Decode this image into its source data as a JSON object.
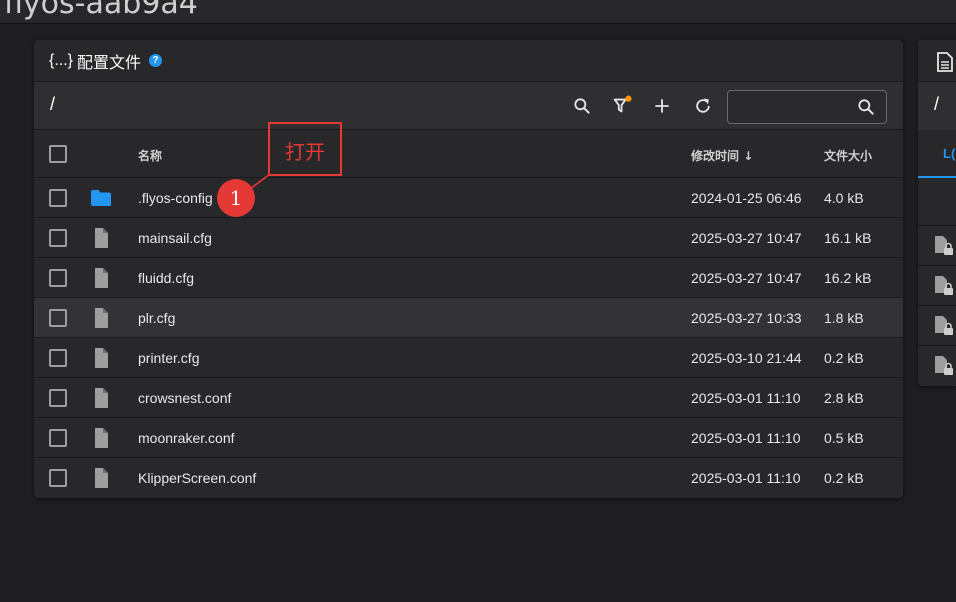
{
  "window": {
    "title": "flyos-aab9a4"
  },
  "panel": {
    "title": "配置文件",
    "braces": "{...}",
    "help_icon": "?",
    "path": "/",
    "search": {
      "value": "",
      "placeholder": ""
    },
    "columns": {
      "name": "名称",
      "modified": "修改时间",
      "sort_indicator": "↓",
      "size": "文件大小"
    },
    "files": [
      {
        "name": ".flyos-config",
        "modified": "2024-01-25 06:46",
        "size": "4.0 kB",
        "type": "folder"
      },
      {
        "name": "mainsail.cfg",
        "modified": "2025-03-27 10:47",
        "size": "16.1 kB",
        "type": "file"
      },
      {
        "name": "fluidd.cfg",
        "modified": "2025-03-27 10:47",
        "size": "16.2 kB",
        "type": "file"
      },
      {
        "name": "plr.cfg",
        "modified": "2025-03-27 10:33",
        "size": "1.8 kB",
        "type": "file"
      },
      {
        "name": "printer.cfg",
        "modified": "2025-03-10 21:44",
        "size": "0.2 kB",
        "type": "file"
      },
      {
        "name": "crowsnest.conf",
        "modified": "2025-03-01 11:10",
        "size": "2.8 kB",
        "type": "file"
      },
      {
        "name": "moonraker.conf",
        "modified": "2025-03-01 11:10",
        "size": "0.5 kB",
        "type": "file"
      },
      {
        "name": "KlipperScreen.conf",
        "modified": "2025-03-01 11:10",
        "size": "0.2 kB",
        "type": "file"
      }
    ]
  },
  "side_panel": {
    "path": "/",
    "tab_label": "L("
  },
  "annotation": {
    "label": "打开",
    "number": "1"
  },
  "colors": {
    "accent": "#2196f3",
    "annotation": "#e53935",
    "filter_dot": "#ff9800",
    "background": "#1e1e20",
    "panel": "#28282b"
  }
}
